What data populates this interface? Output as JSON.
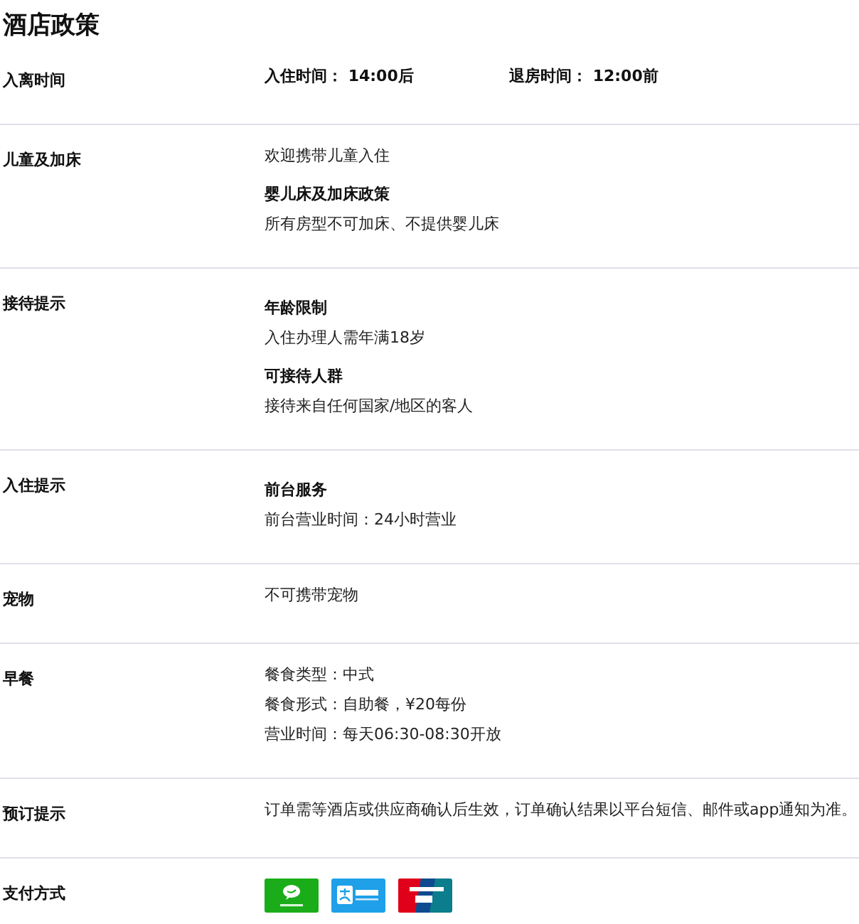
{
  "title": "酒店政策",
  "sections": [
    {
      "label": "入离时间",
      "items": [
        {
          "kind": "inline",
          "texts": [
            "入住时间： 14:00后",
            "退房时间： 12:00前"
          ]
        }
      ]
    },
    {
      "label": "儿童及加床",
      "items": [
        {
          "kind": "text",
          "text": "欢迎携带儿童入住"
        },
        {
          "kind": "subheading",
          "text": "婴儿床及加床政策"
        },
        {
          "kind": "text",
          "text": "所有房型不可加床、不提供婴儿床"
        }
      ]
    },
    {
      "label": "接待提示",
      "items": [
        {
          "kind": "subheading",
          "text": "年龄限制"
        },
        {
          "kind": "text",
          "text": "入住办理人需年满18岁"
        },
        {
          "kind": "subheading",
          "text": "可接待人群"
        },
        {
          "kind": "text",
          "text": "接待来自任何国家/地区的客人"
        }
      ]
    },
    {
      "label": "入住提示",
      "items": [
        {
          "kind": "subheading",
          "text": "前台服务"
        },
        {
          "kind": "text",
          "text": "前台营业时间：24小时营业"
        }
      ]
    },
    {
      "label": "宠物",
      "items": [
        {
          "kind": "text",
          "text": "不可携带宠物"
        }
      ]
    },
    {
      "label": "早餐",
      "items": [
        {
          "kind": "text",
          "text": "餐食类型：中式"
        },
        {
          "kind": "text",
          "text": "餐食形式：自助餐，¥20每份"
        },
        {
          "kind": "text",
          "text": "营业时间：每天06:30-08:30开放"
        }
      ]
    },
    {
      "label": "预订提示",
      "items": [
        {
          "kind": "text",
          "text": "订单需等酒店或供应商确认后生效，订单确认结果以平台短信、邮件或app通知为准。"
        }
      ]
    },
    {
      "label": "支付方式",
      "items": [
        {
          "kind": "payments",
          "methods": [
            {
              "kind": "wechat"
            },
            {
              "kind": "alipay"
            },
            {
              "kind": "unionpay"
            }
          ]
        }
      ]
    }
  ]
}
